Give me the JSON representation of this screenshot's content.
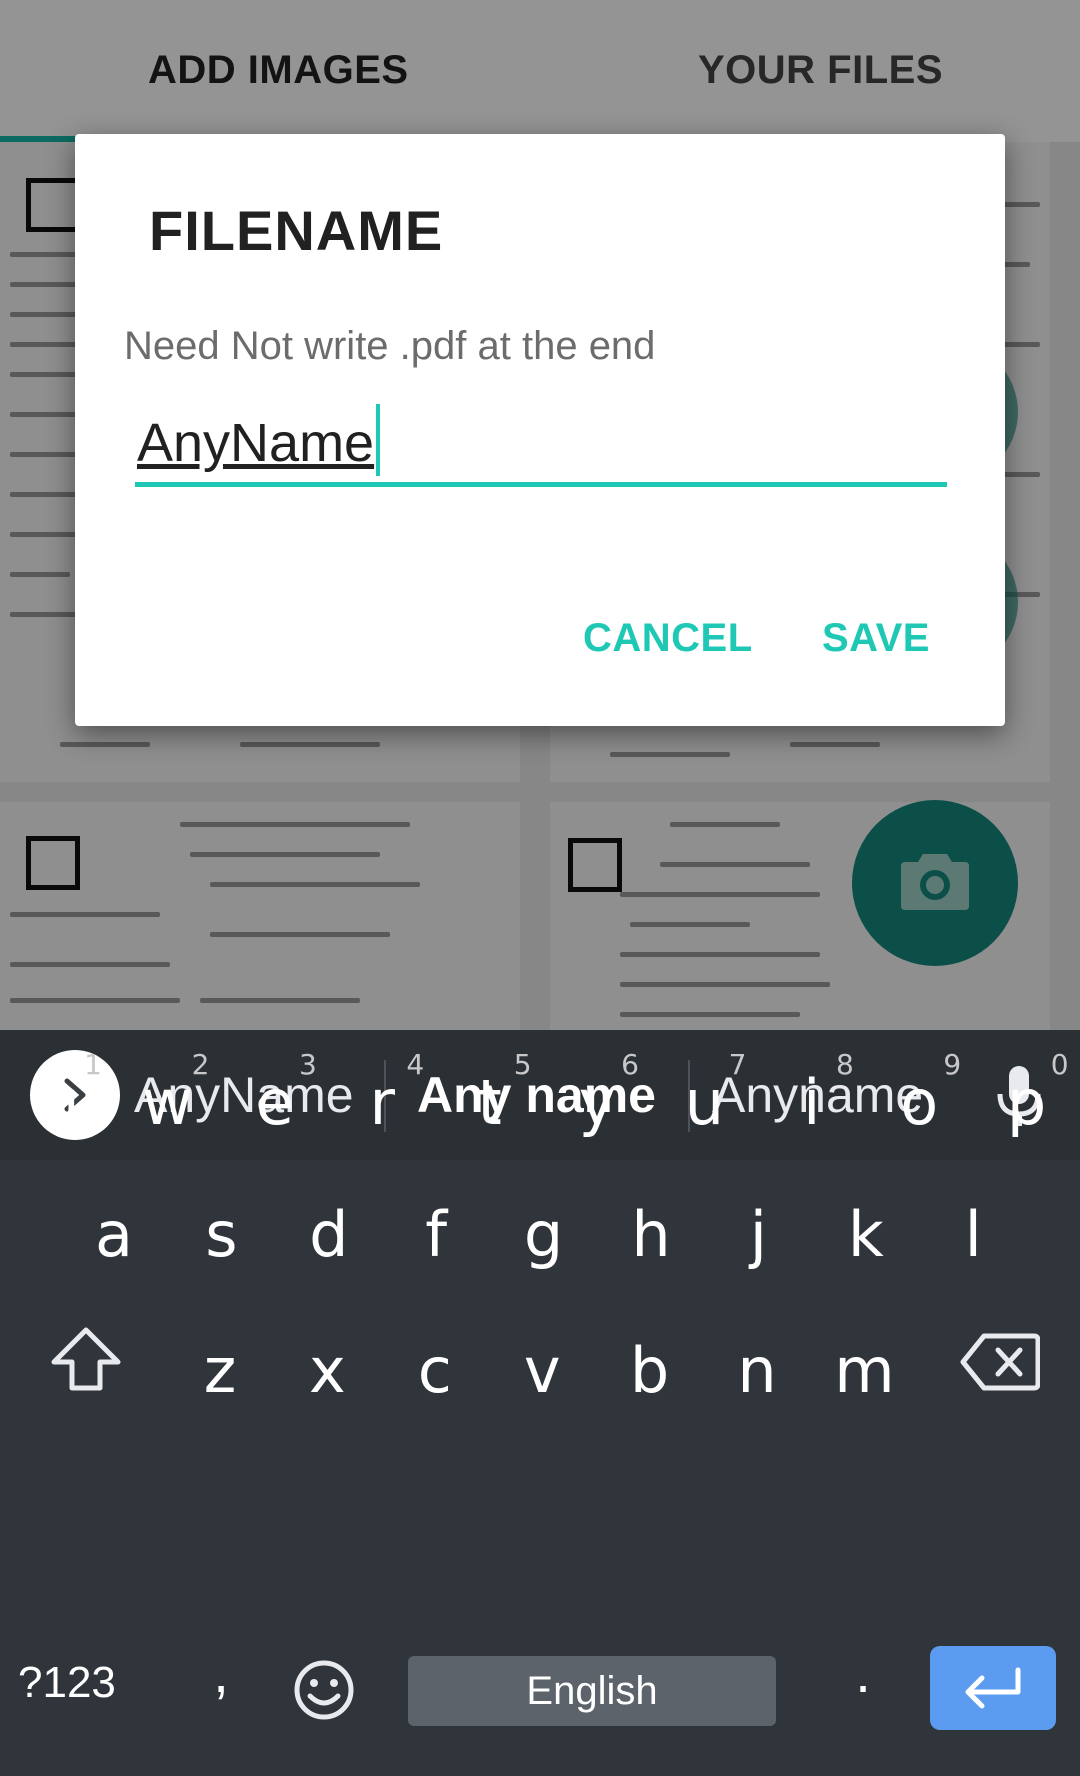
{
  "tabs": [
    {
      "label": "ADD IMAGES",
      "selected": true
    },
    {
      "label": "YOUR FILES",
      "selected": false
    }
  ],
  "accent_color": "#17b7a6",
  "fab": {
    "icon": "camera-icon",
    "color": "#16897d"
  },
  "dialog": {
    "title": "FILENAME",
    "message": "Need Not write .pdf at the end",
    "input_value": "AnyName",
    "cancel_label": "CANCEL",
    "save_label": "SAVE"
  },
  "keyboard": {
    "suggestions": [
      "AnyName",
      "Any name",
      "Anyname"
    ],
    "row1": [
      {
        "key": "q",
        "hint": "1"
      },
      {
        "key": "w",
        "hint": "2"
      },
      {
        "key": "e",
        "hint": "3"
      },
      {
        "key": "r",
        "hint": "4"
      },
      {
        "key": "t",
        "hint": "5"
      },
      {
        "key": "y",
        "hint": "6"
      },
      {
        "key": "u",
        "hint": "7"
      },
      {
        "key": "i",
        "hint": "8"
      },
      {
        "key": "o",
        "hint": "9"
      },
      {
        "key": "p",
        "hint": "0"
      }
    ],
    "row2": [
      "a",
      "s",
      "d",
      "f",
      "g",
      "h",
      "j",
      "k",
      "l"
    ],
    "row3": [
      "z",
      "x",
      "c",
      "v",
      "b",
      "n",
      "m"
    ],
    "symbols_label": "?123",
    "comma": ",",
    "space_label": "English",
    "period": ".",
    "enter_color": "#5b9cf0"
  }
}
